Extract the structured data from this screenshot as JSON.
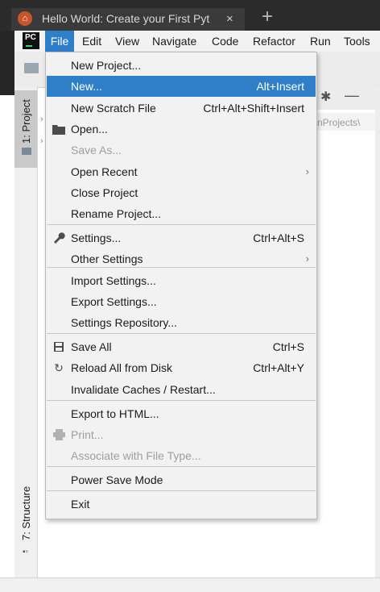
{
  "browser": {
    "tab_title": "Hello World: Create your First Pyt",
    "tab_close": "×",
    "new_tab": "+"
  },
  "menubar": {
    "logo": "PC",
    "items": [
      "File",
      "Edit",
      "View",
      "Navigate",
      "Code",
      "Refactor",
      "Run",
      "Tools"
    ],
    "active": "File"
  },
  "sidebar": {
    "project_tab": "1: Project",
    "structure_tab": "7: Structure"
  },
  "panel": {
    "path_fragment": "nProjects\\"
  },
  "file_menu": {
    "items": [
      {
        "label": "New Project...",
        "shortcut": "",
        "submenu": false,
        "disabled": false,
        "selected": false,
        "icon": ""
      },
      {
        "label": "New...",
        "shortcut": "Alt+Insert",
        "submenu": false,
        "disabled": false,
        "selected": true,
        "icon": ""
      },
      {
        "label": "New Scratch File",
        "shortcut": "Ctrl+Alt+Shift+Insert",
        "submenu": false,
        "disabled": false,
        "selected": false,
        "icon": ""
      },
      {
        "label": "Open...",
        "shortcut": "",
        "submenu": false,
        "disabled": false,
        "selected": false,
        "icon": "folder-icon"
      },
      {
        "label": "Save As...",
        "shortcut": "",
        "submenu": false,
        "disabled": true,
        "selected": false,
        "icon": ""
      },
      {
        "label": "Open Recent",
        "shortcut": "",
        "submenu": true,
        "disabled": false,
        "selected": false,
        "icon": ""
      },
      {
        "label": "Close Project",
        "shortcut": "",
        "submenu": false,
        "disabled": false,
        "selected": false,
        "icon": ""
      },
      {
        "label": "Rename Project...",
        "shortcut": "",
        "submenu": false,
        "disabled": false,
        "selected": false,
        "icon": ""
      },
      {
        "label": "Settings...",
        "shortcut": "Ctrl+Alt+S",
        "submenu": false,
        "disabled": false,
        "selected": false,
        "icon": "wrench-icon"
      },
      {
        "label": "Other Settings",
        "shortcut": "",
        "submenu": true,
        "disabled": false,
        "selected": false,
        "icon": ""
      },
      {
        "label": "Import Settings...",
        "shortcut": "",
        "submenu": false,
        "disabled": false,
        "selected": false,
        "icon": ""
      },
      {
        "label": "Export Settings...",
        "shortcut": "",
        "submenu": false,
        "disabled": false,
        "selected": false,
        "icon": ""
      },
      {
        "label": "Settings Repository...",
        "shortcut": "",
        "submenu": false,
        "disabled": false,
        "selected": false,
        "icon": ""
      },
      {
        "label": "Save All",
        "shortcut": "Ctrl+S",
        "submenu": false,
        "disabled": false,
        "selected": false,
        "icon": "save-icon"
      },
      {
        "label": "Reload All from Disk",
        "shortcut": "Ctrl+Alt+Y",
        "submenu": false,
        "disabled": false,
        "selected": false,
        "icon": "reload-icon"
      },
      {
        "label": "Invalidate Caches / Restart...",
        "shortcut": "",
        "submenu": false,
        "disabled": false,
        "selected": false,
        "icon": ""
      },
      {
        "label": "Export to HTML...",
        "shortcut": "",
        "submenu": false,
        "disabled": false,
        "selected": false,
        "icon": ""
      },
      {
        "label": "Print...",
        "shortcut": "",
        "submenu": false,
        "disabled": true,
        "selected": false,
        "icon": "print-icon"
      },
      {
        "label": "Associate with File Type...",
        "shortcut": "",
        "submenu": false,
        "disabled": true,
        "selected": false,
        "icon": ""
      },
      {
        "label": "Power Save Mode",
        "shortcut": "",
        "submenu": false,
        "disabled": false,
        "selected": false,
        "icon": ""
      },
      {
        "label": "Exit",
        "shortcut": "",
        "submenu": false,
        "disabled": false,
        "selected": false,
        "icon": ""
      }
    ]
  },
  "colors": {
    "selection": "#2f7fc8",
    "menu_bg": "#f2f2f2",
    "disabled_text": "#9e9e9e"
  }
}
